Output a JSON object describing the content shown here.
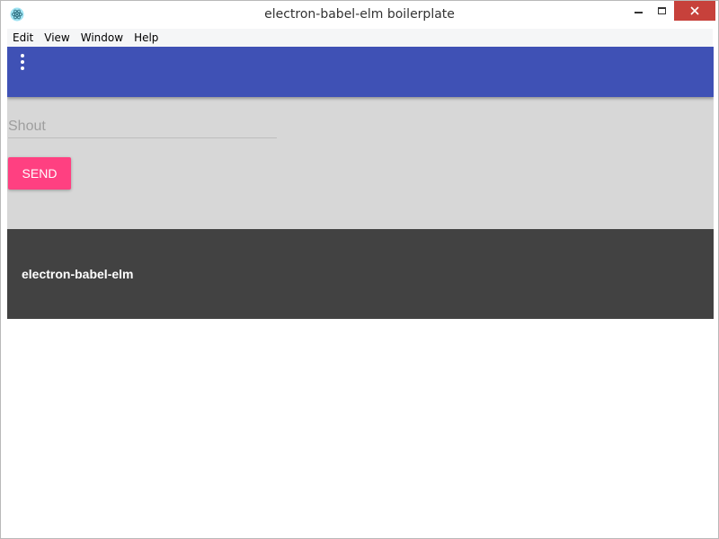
{
  "window": {
    "title": "electron-babel-elm boilerplate",
    "icon": "electron-app-icon",
    "controls": [
      "minimize-icon",
      "maximize-icon",
      "close-icon"
    ],
    "close_color": "#c7413b"
  },
  "menubar": {
    "items": [
      "Edit",
      "View",
      "Window",
      "Help"
    ]
  },
  "header": {
    "color": "#3f51b5",
    "menu_icon": "more-vertical-icon"
  },
  "form": {
    "background": "#d7d7d7",
    "shout_placeholder": "Shout",
    "shout_value": "",
    "send_label": "SEND",
    "send_color": "#ff4081"
  },
  "footer": {
    "background": "#424242",
    "text": "electron-babel-elm"
  }
}
